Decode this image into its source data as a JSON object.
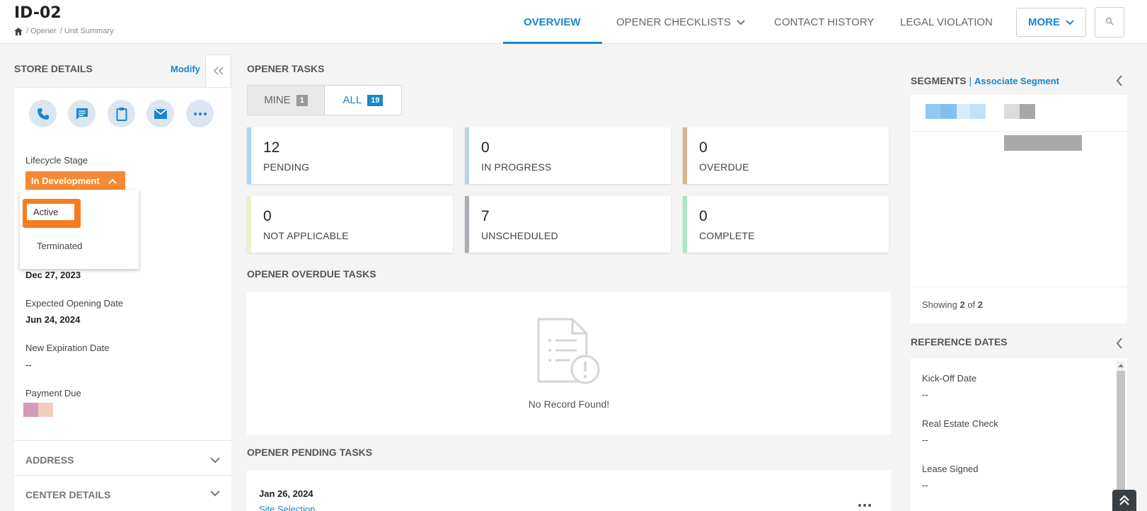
{
  "header": {
    "title": "ID-02",
    "breadcrumb": [
      "/ Opener",
      "/ Unit Summary"
    ],
    "tabs": {
      "overview": "OVERVIEW",
      "opener_checklists": "OPENER CHECKLISTS",
      "contact_history": "CONTACT HISTORY",
      "legal_violation": "LEGAL VIOLATION"
    },
    "more_label": "MORE"
  },
  "store_details": {
    "title": "STORE DETAILS",
    "modify_label": "Modify",
    "lifecycle_label": "Lifecycle Stage",
    "lifecycle_value": "In Development",
    "dropdown_options": [
      "Active",
      "Terminated"
    ],
    "hidden_date_value": "Dec 27, 2023",
    "expected_opening_label": "Expected Opening Date",
    "expected_opening_value": "Jun 24, 2024",
    "new_expiration_label": "New Expiration Date",
    "new_expiration_value": "--",
    "payment_due_label": "Payment Due",
    "sections": [
      "ADDRESS",
      "CENTER DETAILS"
    ]
  },
  "opener_tasks": {
    "title": "OPENER TASKS",
    "toggle": {
      "mine_label": "MINE",
      "mine_count": "1",
      "all_label": "ALL",
      "all_count": "19"
    },
    "stats": [
      {
        "value": "12",
        "label": "PENDING",
        "color": "#a8d4f5"
      },
      {
        "value": "0",
        "label": "IN PROGRESS",
        "color": "#b7d3ea"
      },
      {
        "value": "0",
        "label": "OVERDUE",
        "color": "#d8b48f"
      },
      {
        "value": "0",
        "label": "NOT APPLICABLE",
        "color": "#eef0c9"
      },
      {
        "value": "7",
        "label": "UNSCHEDULED",
        "color": "#a9aeb3"
      },
      {
        "value": "0",
        "label": "COMPLETE",
        "color": "#a8e8c6"
      }
    ]
  },
  "overdue_tasks": {
    "title": "OPENER OVERDUE TASKS",
    "empty_text": "No Record Found!"
  },
  "pending_tasks": {
    "title": "OPENER PENDING TASKS",
    "first_date": "Jan 26, 2024",
    "first_link": "Site Selection"
  },
  "segments": {
    "title": "SEGMENTS",
    "separator": "|",
    "associate_label": "Associate Segment",
    "showing_prefix": "Showing ",
    "showing_count": "2",
    "showing_of": " of ",
    "showing_total": "2"
  },
  "reference_dates": {
    "title": "REFERENCE DATES",
    "items": [
      {
        "label": "Kick-Off Date",
        "value": "--"
      },
      {
        "label": "Real Estate Check",
        "value": "--"
      },
      {
        "label": "Lease Signed",
        "value": "--"
      }
    ]
  },
  "colors": {
    "accent": "#1b86c9",
    "stage": "#f48a34",
    "dropdown_highlight": "#f57c1f"
  }
}
